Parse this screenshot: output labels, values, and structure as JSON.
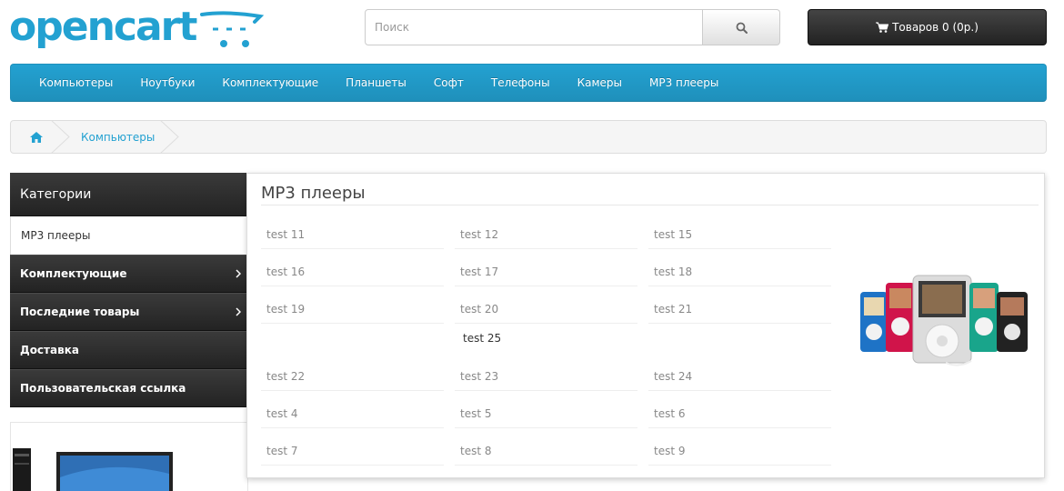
{
  "header": {
    "logo_text": "opencart",
    "search": {
      "placeholder": "Поиск",
      "value": ""
    },
    "cart": {
      "label": "Товаров 0 (0р.)"
    }
  },
  "menu": {
    "items": [
      "Компьютеры",
      "Ноутбуки",
      "Комплектующие",
      "Планшеты",
      "Софт",
      "Телефоны",
      "Камеры",
      "MP3 плееры"
    ]
  },
  "breadcrumb": {
    "current": "Компьютеры"
  },
  "sidebar": {
    "title": "Категории",
    "items": [
      {
        "label": "MP3 плееры",
        "active": true,
        "has_children": false
      },
      {
        "label": "Комплектующие",
        "active": false,
        "has_children": true
      },
      {
        "label": "Последние товары",
        "active": false,
        "has_children": true
      },
      {
        "label": "Доставка",
        "active": false,
        "has_children": false
      },
      {
        "label": "Пользовательская ссылка",
        "active": false,
        "has_children": false
      }
    ]
  },
  "dropdown": {
    "title": "MP3 плееры",
    "items": [
      [
        "test 11",
        "test 12",
        "test 15"
      ],
      [
        "test 16",
        "test 17",
        "test 18"
      ],
      [
        "test 19",
        "test 20",
        "test 21"
      ],
      [
        "",
        "test 25",
        ""
      ],
      [
        "test 22",
        "test 23",
        "test 24"
      ],
      [
        "test 4",
        "test 5",
        "test 6"
      ],
      [
        "test 7",
        "test 8",
        "test 9"
      ]
    ]
  },
  "colors": {
    "brand": "#23a1d1",
    "menu_bg": "#23a1d1",
    "dark_bar": "#2d2d2d"
  },
  "icons": [
    "shopping-cart-icon",
    "search-icon",
    "home-icon",
    "chevron-right-icon"
  ]
}
